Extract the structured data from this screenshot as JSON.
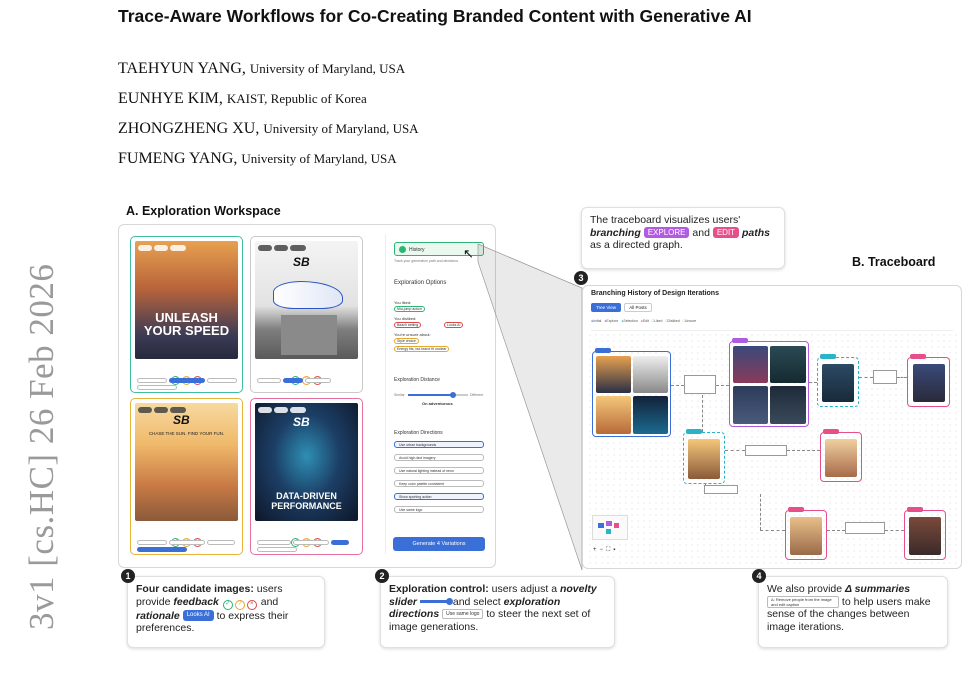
{
  "arxiv_id": "3v1  [cs.HC]  26 Feb 2026",
  "paper_title": "Trace-Aware Workflows for Co-Creating Branded Content with Generative AI",
  "authors": [
    {
      "name": "TAEHYUN YANG,",
      "affiliation": "University of Maryland, USA"
    },
    {
      "name": "EUNHYE KIM,",
      "affiliation": "KAIST, Republic of Korea"
    },
    {
      "name": "ZHONGZHENG XU,",
      "affiliation": "University of Maryland, USA"
    },
    {
      "name": "FUMENG YANG,",
      "affiliation": "University of Maryland, USA"
    }
  ],
  "section_a": "A. Exploration Workspace",
  "section_b": "B. Traceboard",
  "cards": [
    {
      "headline": "UNLEASH\nYOUR SPEED",
      "border": "#3fbf9f",
      "img_top": "#d98a3a",
      "img_bottom": "#2a2f45",
      "logo": "SB"
    },
    {
      "headline": "",
      "border": "#c9c9c9",
      "img_top": "#eeeeee",
      "img_bottom": "#9a9a9a",
      "logo": "SB"
    },
    {
      "headline": "CHASE THE SUN. FIND YOUR FUN.",
      "border": "#e6b23a",
      "img_top": "#f4c77a",
      "img_bottom": "#b86a3a",
      "logo": "SB"
    },
    {
      "headline": "DATA-DRIVEN\nPERFORMANCE",
      "border": "#e66fa0",
      "img_top": "#13213a",
      "img_bottom": "#1b6b8f",
      "logo": "SB"
    }
  ],
  "right_panel": {
    "history_label": "History",
    "history_sub": "Track your generation path and decisions",
    "exploration_options": "Exploration Options",
    "you_liked": "You liked:",
    "liked_item": "Mid-jump action",
    "you_disliked": "You disliked:",
    "disliked_items": [
      "Beach setting",
      "Looks AI"
    ],
    "unsure_label": "You're unsure about:",
    "unsure_items": [
      "Style choice",
      "Energy fits, but brand fit unclear"
    ],
    "exploration_distance": "Exploration Distance",
    "slider_left": "Similar",
    "slider_right": "Different",
    "slider_value": "On adventurous",
    "novelty_level": 0.75,
    "exploration_directions": "Exploration Directions",
    "directions": [
      "Use urban backgrounds",
      "Avoid high-fact imagery",
      "Use natural lighting instead of neon",
      "Keep color palette consistent",
      "Show sporting action",
      "Use same logo"
    ],
    "generate_button": "Generate 4 Variations"
  },
  "callouts": {
    "c1_num": "1",
    "c1_bold": "Four candidate images:",
    "c1_text1": " users provide ",
    "c1_feedback": "feedback",
    "c1_and": " and",
    "c1_rationale": "rationale",
    "c1_chip": "Looks AI",
    "c1_text2": " to express their preferences.",
    "c2_num": "2",
    "c2_bold": "Exploration control:",
    "c2_text1": " users adjust a ",
    "c2_slider": "novelty slider",
    "c2_text2": " and select ",
    "c2_dirs": "exploration directions",
    "c2_chip": "Use same logo",
    "c2_text3": " to steer the next set of image generations.",
    "c3_num": "3",
    "c3_text1": "The traceboard visualizes users' ",
    "c3_branching": "branching",
    "c3_explore": "EXPLORE",
    "c3_and": " and ",
    "c3_edit": "EDIT",
    "c3_paths": "paths",
    "c3_text2": " as a directed graph.",
    "c4_num": "4",
    "c4_text1": "We also provide ",
    "c4_delta": "Δ summaries",
    "c4_chip": "Δ: Remove people from the image and edit caption",
    "c4_text2": " to help users make sense of the changes between image iterations."
  },
  "traceboard": {
    "title": "Branching History of Design Iterations",
    "tabs": [
      "Tree View",
      "All Posts"
    ],
    "legend": [
      "Initial",
      "Explore",
      "Selection",
      "Edit",
      "Liked",
      "Disliked",
      "Unsure"
    ],
    "colors": {
      "explore": "#b15be0",
      "edit": "#e64f8a",
      "selected": "#28b3c7",
      "initial": "#3b6fd8"
    }
  }
}
